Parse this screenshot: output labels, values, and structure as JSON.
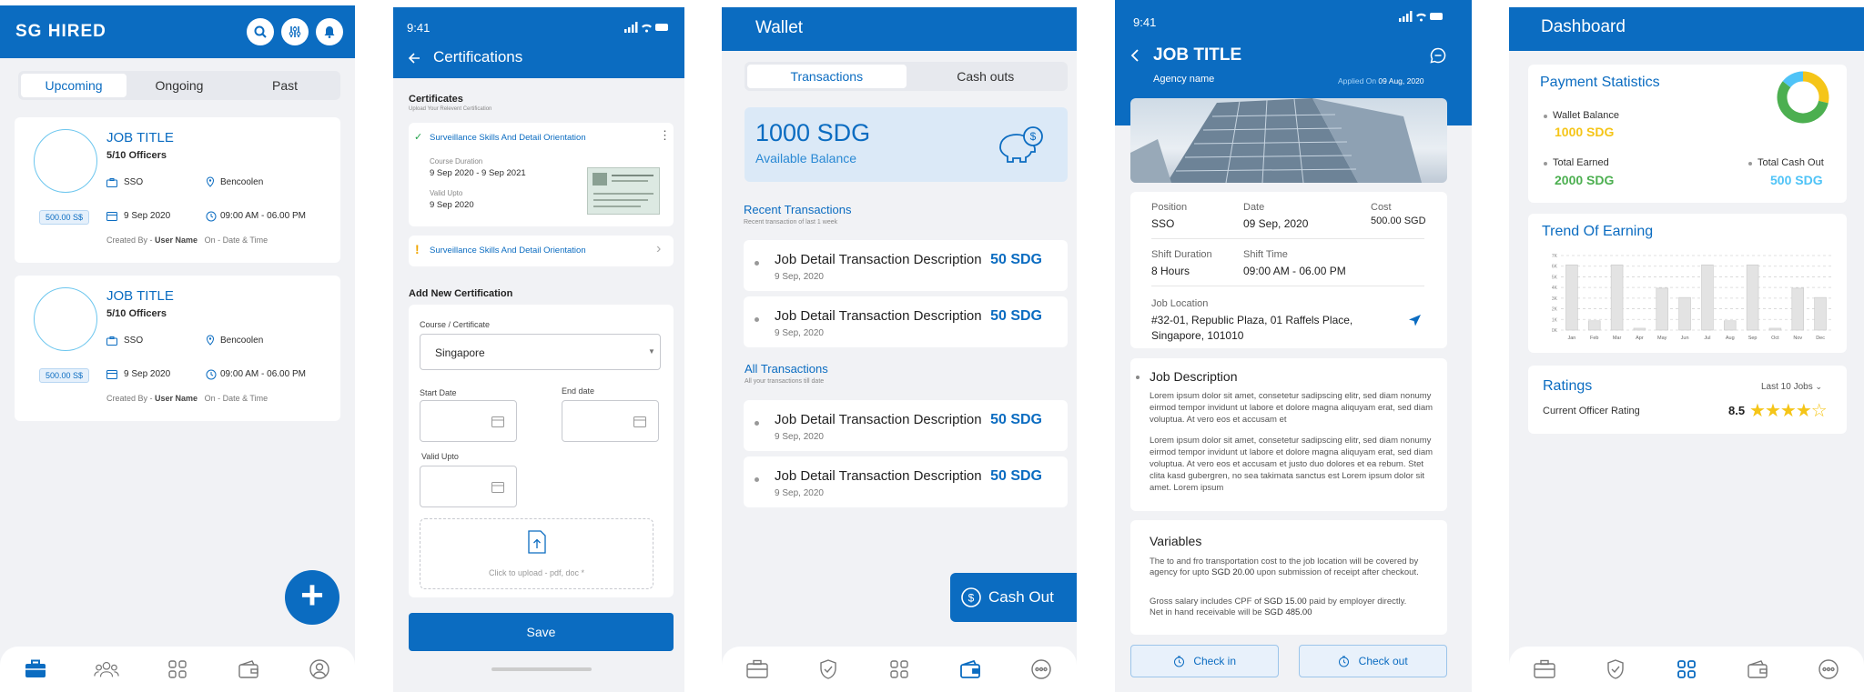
{
  "jobs_screen": {
    "brand": "SG HIRED",
    "tabs": [
      "Upcoming",
      "Ongoing",
      "Past"
    ],
    "cards": [
      {
        "title": "JOB TITLE",
        "officers": "5/10 Officers",
        "position": "SSO",
        "location": "Bencoolen",
        "price": "500.00 S$",
        "date": "9 Sep 2020",
        "time": "09:00 AM - 06.00 PM",
        "created_prefix": "Created By - ",
        "created_user": "User Name",
        "created_suffix": "On - Date & Time"
      },
      {
        "title": "JOB TITLE",
        "officers": "5/10 Officers",
        "position": "SSO",
        "location": "Bencoolen",
        "price": "500.00 S$",
        "date": "9 Sep 2020",
        "time": "09:00 AM - 06.00 PM",
        "created_prefix": "Created By - ",
        "created_user": "User Name",
        "created_suffix": "On - Date & Time"
      }
    ],
    "fab": "+"
  },
  "cert_screen": {
    "time": "9:41",
    "title": "Certifications",
    "section_title": "Certificates",
    "section_sub": "Upload Your Relevent Certification",
    "cert1": {
      "name": "Surveillance Skills And Detail Orientation",
      "dur_label": "Course Duration",
      "dur": "9 Sep 2020 - 9 Sep 2021",
      "valid_label": "Valid Upto",
      "valid": "9 Sep 2020"
    },
    "cert2": {
      "name": "Surveillance Skills And Detail Orientation"
    },
    "add_title": "Add New Certification",
    "course_label": "Course / Certificate",
    "course_value": "Singapore",
    "start_label": "Start Date",
    "end_label": "End date",
    "valid_label": "Valid Upto",
    "upload_text": "Click to upload - pdf, doc *",
    "save": "Save"
  },
  "wallet_screen": {
    "title": "Wallet",
    "tabs": [
      "Transactions",
      "Cash outs"
    ],
    "balance": "1000 SDG",
    "balance_label": "Available Balance",
    "recent_title": "Recent Transactions",
    "recent_sub": "Recent transaction of last 1 week",
    "all_title": "All Transactions",
    "all_sub": "All your transactions till date",
    "recent": [
      {
        "desc": "Job Detail Transaction Description",
        "date": "9 Sep, 2020",
        "amount": "50 SDG"
      },
      {
        "desc": "Job Detail Transaction Description",
        "date": "9 Sep, 2020",
        "amount": "50 SDG"
      }
    ],
    "all": [
      {
        "desc": "Job Detail Transaction Description",
        "date": "9 Sep, 2020",
        "amount": "50 SDG"
      },
      {
        "desc": "Job Detail Transaction Description",
        "date": "9 Sep, 2020",
        "amount": "50 SDG"
      }
    ],
    "cashout": "Cash Out"
  },
  "job_screen": {
    "time": "9:41",
    "title": "JOB TITLE",
    "agency": "Agency name",
    "applied_label": "Applied On ",
    "applied_date": "09 Aug, 2020",
    "position_label": "Position",
    "position": "SSO",
    "date_label": "Date",
    "date": "09 Sep, 2020",
    "cost_label": "Cost",
    "cost": "500.00 SGD",
    "shift_dur_label": "Shift Duration",
    "shift_dur": "8 Hours",
    "shift_time_label": "Shift Time",
    "shift_time": "09:00 AM - 06.00 PM",
    "loc_label": "Job Location",
    "loc_line1": "#32-01, Republic Plaza, 01 Raffels Place,",
    "loc_line2": "Singapore, 101010",
    "desc_title": "Job Description",
    "desc_p1": "Lorem ipsum dolor sit amet, consetetur sadipscing elitr, sed diam nonumy eirmod tempor invidunt ut labore et dolore magna aliquyam erat, sed diam voluptua. At vero eos et accusam et",
    "desc_p2": "Lorem ipsum dolor sit amet, consetetur sadipscing elitr, sed diam nonumy eirmod tempor invidunt ut labore et dolore magna aliquyam erat, sed diam voluptua. At vero eos et accusam et justo duo dolores et ea rebum. Stet clita kasd gubergren, no sea takimata sanctus est Lorem ipsum dolor sit amet. Lorem ipsum",
    "var_title": "Variables",
    "var_p1a": "The to and fro transportation cost to the job location will be covered by agency for upto ",
    "var_p1b": "SGD 20.00",
    "var_p1c": " upon submission of receipt after checkout.",
    "var_p2a": "Gross salary includes CPF of ",
    "var_p2b": "SGD 15.00",
    "var_p2c": " paid by employer directly.",
    "var_p3a": "Net in hand receivable will be ",
    "var_p3b": "SGD 485.00",
    "checkin": "Check in",
    "checkout": "Check out"
  },
  "dash_screen": {
    "title": "Dashboard",
    "pay_title": "Payment Statistics",
    "wallet_label": "Wallet Balance",
    "wallet_val": "1000 SDG",
    "earned_label": "Total Earned",
    "earned_val": "2000 SDG",
    "cashout_label": "Total Cash Out",
    "cashout_val": "500 SDG",
    "trend_title": "Trend Of Earning",
    "ratings_title": "Ratings",
    "ratings_filter": "Last 10 Jobs",
    "rating_label": "Current Officer Rating",
    "rating_value": "8.5",
    "colors": {
      "yellow": "#f5c518",
      "green": "#4caf50",
      "cyan": "#4fc3f7"
    }
  },
  "chart_data": [
    {
      "type": "pie",
      "categories": [
        "Wallet Balance",
        "Total Earned",
        "Total Cash Out"
      ],
      "values": [
        1000,
        2000,
        500
      ],
      "title": ""
    },
    {
      "type": "bar",
      "title": "Trend Of Earning",
      "categories": [
        "Jan",
        "Feb",
        "Mar",
        "Apr",
        "May",
        "Jun",
        "Jul",
        "Aug",
        "Sep",
        "Oct",
        "Nov",
        "Dec"
      ],
      "values": [
        70,
        10,
        70,
        2,
        45,
        35,
        70,
        10,
        70,
        2,
        45,
        35
      ],
      "ytick_labels": [
        "7K",
        "6K",
        "5K",
        "4K",
        "3K",
        "2K",
        "1K",
        "0K"
      ],
      "ylim": [
        0,
        80
      ],
      "grid": true
    }
  ]
}
